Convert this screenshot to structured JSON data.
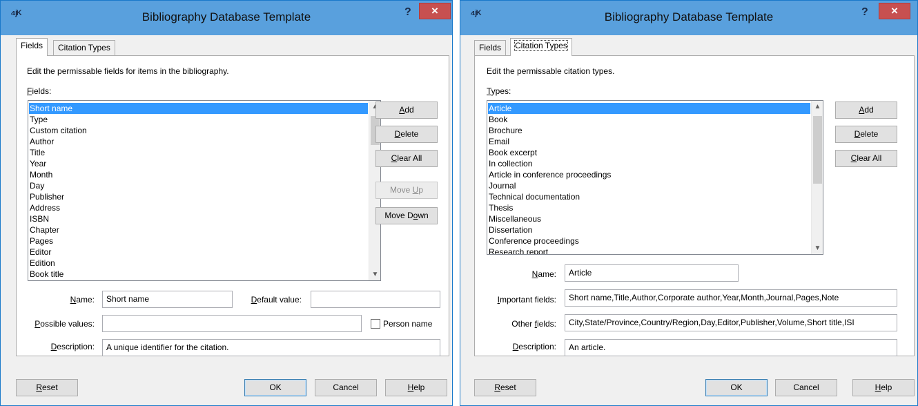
{
  "app_icon_glyph": "⁴ʲᴷ",
  "dialog_title": "Bibliography Database Template",
  "title_help": "?",
  "title_close": "×",
  "tabs": {
    "fields": "Fields",
    "citation_types": "Citation Types"
  },
  "fields_panel": {
    "instruction": "Edit the permissable fields for items in the bibliography.",
    "list_label": "Fields:",
    "items": [
      "Short name",
      "Type",
      "Custom citation",
      "Author",
      "Title",
      "Year",
      "Month",
      "Day",
      "Publisher",
      "Address",
      "ISBN",
      "Chapter",
      "Pages",
      "Editor",
      "Edition",
      "Book title"
    ],
    "selected_item": "Short name",
    "buttons": {
      "add": "Add",
      "delete": "Delete",
      "clear_all": "Clear All",
      "move_up": "Move Up",
      "move_down": "Move Down"
    },
    "name_label": "Name:",
    "name_value": "Short name",
    "default_value_label": "Default value:",
    "default_value": "",
    "possible_values_label": "Possible values:",
    "possible_values": "",
    "person_name_label": "Person name",
    "person_name_checked": false,
    "description_label": "Description:",
    "description_value": "A unique identifier for the citation."
  },
  "types_panel": {
    "instruction": "Edit the permissable citation types.",
    "list_label": "Types:",
    "items": [
      "Article",
      "Book",
      "Brochure",
      "Email",
      "Book excerpt",
      "In collection",
      "Article in conference proceedings",
      "Journal",
      "Technical documentation",
      "Thesis",
      "Miscellaneous",
      "Dissertation",
      "Conference proceedings",
      "Research report"
    ],
    "selected_item": "Article",
    "buttons": {
      "add": "Add",
      "delete": "Delete",
      "clear_all": "Clear All"
    },
    "name_label": "Name:",
    "name_value": "Article",
    "important_fields_label": "Important fields:",
    "important_fields_value": "Short name,Title,Author,Corporate author,Year,Month,Journal,Pages,Note",
    "other_fields_label": "Other fields:",
    "other_fields_value": "City,State/Province,Country/Region,Day,Editor,Publisher,Volume,Short title,ISI",
    "description_label": "Description:",
    "description_value": "An article."
  },
  "footer": {
    "reset": "Reset",
    "ok": "OK",
    "cancel": "Cancel",
    "help": "Help"
  }
}
